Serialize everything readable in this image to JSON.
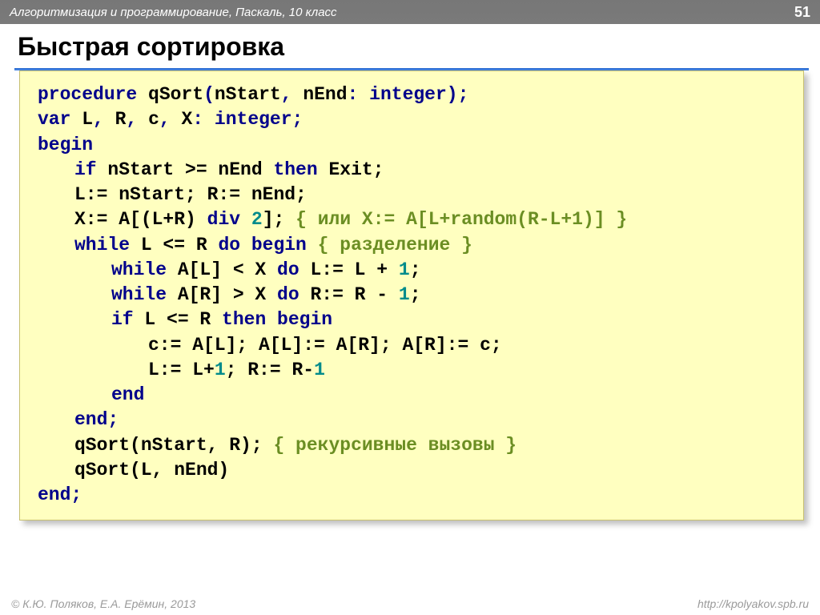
{
  "header": {
    "breadcrumb": "Алгоритмизация и программирование, Паскаль, 10 класс",
    "page": "51"
  },
  "title": "Быстрая сортировка",
  "code": {
    "l1": {
      "a": "procedure",
      "b": " qSort",
      "c": "(",
      "d": "nStart",
      "e": ",",
      "f": " nEnd",
      "g": ":",
      "h": "integer",
      "i": ");"
    },
    "l2": {
      "a": "var",
      "b": " L",
      "c": ",",
      "d": " R",
      "e": ",",
      "f": " c",
      "g": ",",
      "h": " X",
      "i": ":",
      "j": "integer",
      "k": ";"
    },
    "l3": {
      "a": "begin"
    },
    "l4": {
      "a": "if",
      "b": " nStart >= nEnd ",
      "c": "then",
      "d": " Exit;"
    },
    "l5": {
      "a": "L:= nStart; R:= nEnd;"
    },
    "l6": {
      "a": "X:= A[(L+R)",
      "b": "div",
      "c": "2",
      "d": "]; ",
      "e": "{ или X:= A[L+random(R-L+1)] }"
    },
    "l7": {
      "a": "while",
      "b": " L <= R ",
      "c": "do begin",
      "d": " { разделение }"
    },
    "l8": {
      "a": "while",
      "b": " A[L] < X ",
      "c": "do",
      "d": " L:= L + ",
      "e": "1",
      "f": ";"
    },
    "l9": {
      "a": "while",
      "b": " A[R] > X ",
      "c": "do",
      "d": " R:= R - ",
      "e": "1",
      "f": ";"
    },
    "l10": {
      "a": "if",
      "b": " L <= R ",
      "c": "then begin"
    },
    "l11": {
      "a": "c:= A[L]; A[L]:= A[R]; A[R]:= c;"
    },
    "l12": {
      "a": "L:= L+",
      "b": "1",
      "c": "; R:= R-",
      "d": "1"
    },
    "l13": {
      "a": "end"
    },
    "l14": {
      "a": "end",
      "b": ";"
    },
    "l15": {
      "a": "qSort(nStart, R); ",
      "b": "{ рекурсивные вызовы }"
    },
    "l16": {
      "a": "qSort(L, nEnd)"
    },
    "l17": {
      "a": "end",
      "b": ";"
    }
  },
  "footer": {
    "left": "© К.Ю. Поляков, Е.А. Ерёмин, 2013",
    "right": "http://kpolyakov.spb.ru"
  }
}
